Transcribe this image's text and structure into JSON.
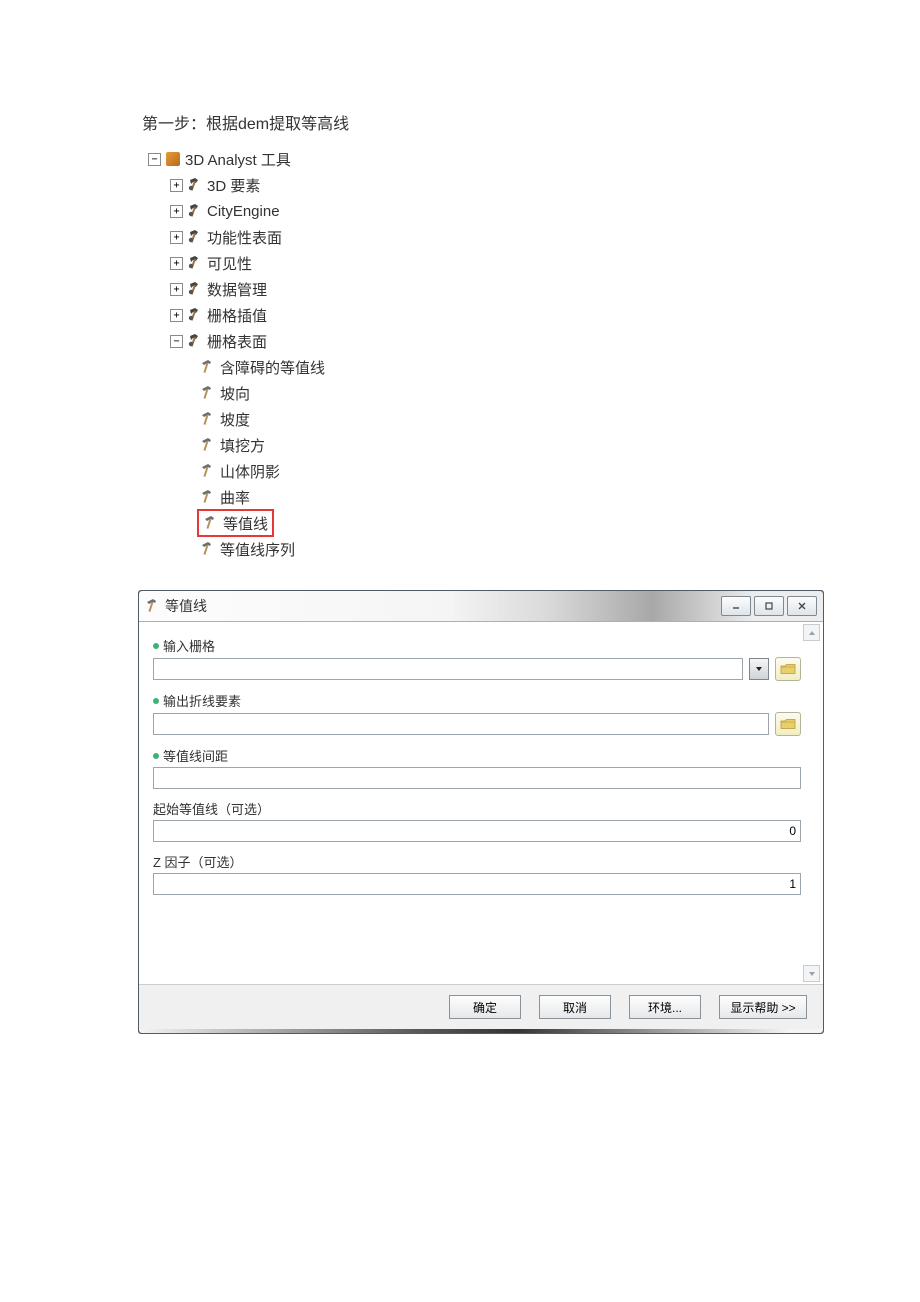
{
  "heading": "第一步：根据dem提取等高线",
  "tree": {
    "root": {
      "label": "3D Analyst 工具",
      "expander": "−"
    },
    "children": [
      {
        "label": "3D 要素",
        "expander": "+"
      },
      {
        "label": "CityEngine",
        "expander": "+"
      },
      {
        "label": "功能性表面",
        "expander": "+"
      },
      {
        "label": "可见性",
        "expander": "+"
      },
      {
        "label": "数据管理",
        "expander": "+"
      },
      {
        "label": "栅格插值",
        "expander": "+"
      },
      {
        "label": "栅格表面",
        "expander": "−"
      }
    ],
    "tools": [
      {
        "label": "含障碍的等值线"
      },
      {
        "label": "坡向"
      },
      {
        "label": "坡度"
      },
      {
        "label": "填挖方"
      },
      {
        "label": "山体阴影"
      },
      {
        "label": "曲率"
      },
      {
        "label": "等值线",
        "highlight": true
      },
      {
        "label": "等值线序列"
      }
    ]
  },
  "dialog": {
    "title": "等值线",
    "fields": {
      "input_raster": {
        "label": "输入栅格",
        "required": true,
        "value": ""
      },
      "output_polyline": {
        "label": "输出折线要素",
        "required": true,
        "value": ""
      },
      "interval": {
        "label": "等值线间距",
        "required": true,
        "value": ""
      },
      "base": {
        "label": "起始等值线（可选）",
        "required": false,
        "value": "0"
      },
      "zfactor": {
        "label": "Z 因子（可选）",
        "required": false,
        "value": "1"
      }
    },
    "buttons": {
      "ok": "确定",
      "cancel": "取消",
      "env": "环境...",
      "help": "显示帮助 >>"
    }
  }
}
